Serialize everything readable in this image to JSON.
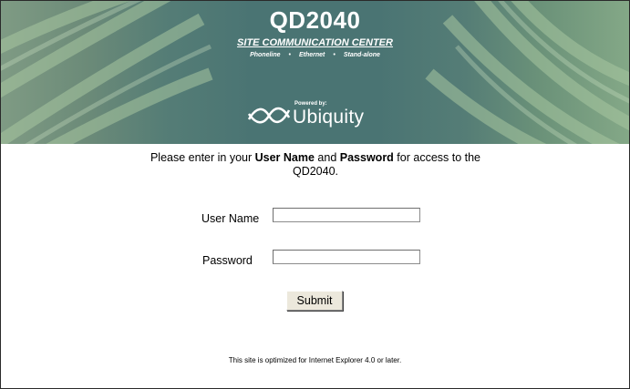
{
  "header": {
    "title": "QD2040",
    "subtitle": "SITE COMMUNICATION CENTER",
    "tagline": [
      "Phoneline",
      "Ethernet",
      "Stand-alone"
    ],
    "powered_by": "Powered by:",
    "brand": "Ubiquity"
  },
  "login": {
    "intro_prefix": "Please enter in your ",
    "intro_user": "User Name",
    "intro_and": " and ",
    "intro_pass": "Password",
    "intro_suffix": " for access to the QD2040.",
    "user_label": "User Name",
    "user_value": "",
    "pass_label": "Password",
    "pass_value": "",
    "submit_label": "Submit"
  },
  "footer": {
    "note": "This site is optimized for Internet Explorer 4.0 or later."
  }
}
